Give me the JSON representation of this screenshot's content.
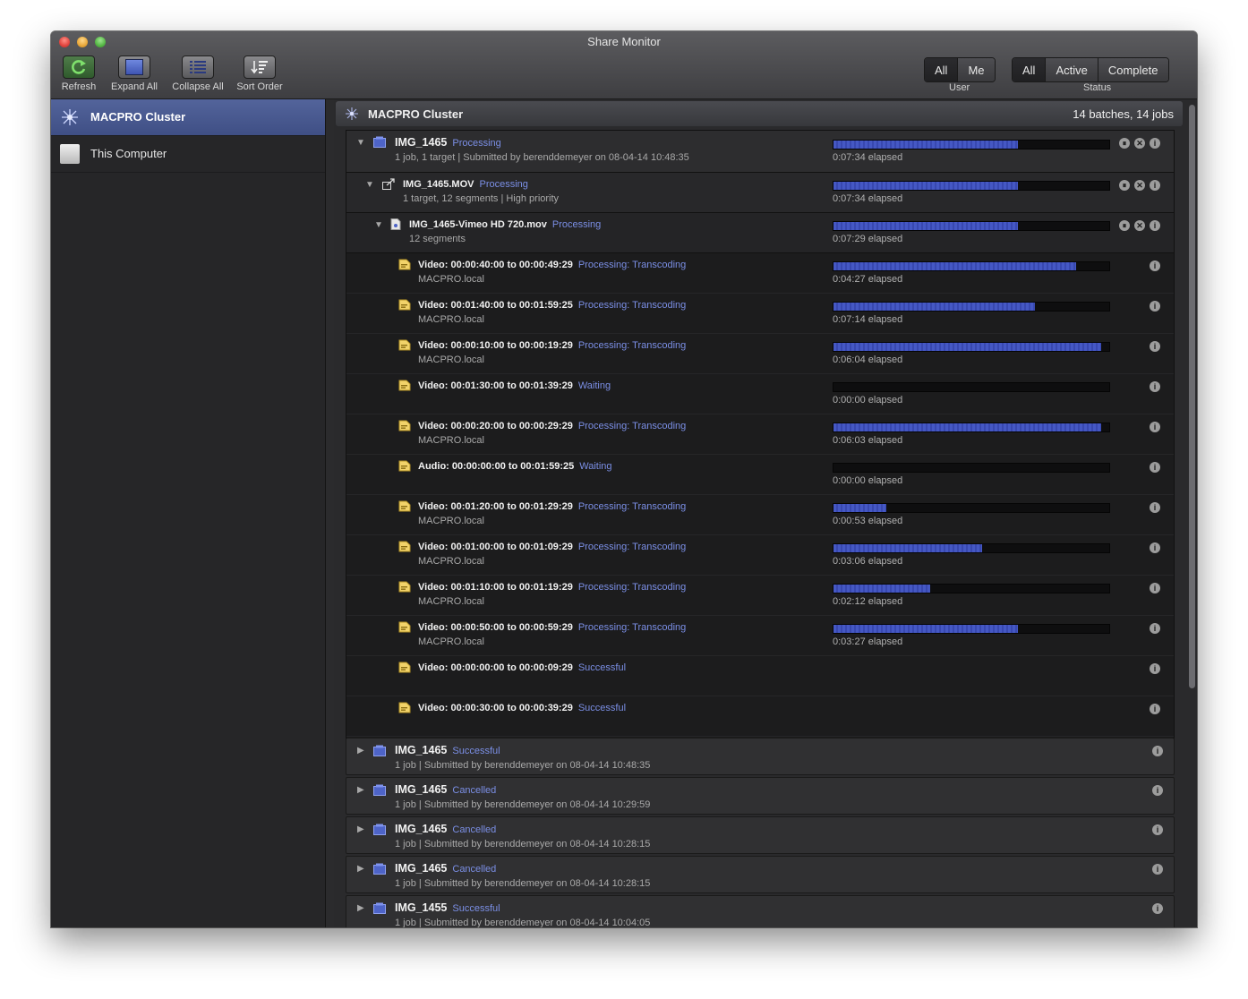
{
  "window": {
    "title": "Share Monitor"
  },
  "toolbar": {
    "refresh_label": "Refresh",
    "expand_label": "Expand All",
    "collapse_label": "Collapse All",
    "sort_label": "Sort Order"
  },
  "filters": {
    "user": {
      "label": "User",
      "options": [
        "All",
        "Me"
      ],
      "selected": "All"
    },
    "status": {
      "label": "Status",
      "options": [
        "All",
        "Active",
        "Complete"
      ],
      "selected": "All"
    }
  },
  "sidebar": {
    "items": [
      {
        "label": "MACPRO Cluster",
        "selected": true,
        "icon": "cluster-icon"
      },
      {
        "label": "This Computer",
        "selected": false,
        "icon": "computer-icon"
      }
    ]
  },
  "cluster": {
    "title": "MACPRO Cluster",
    "summary": "14 batches, 14 jobs"
  },
  "expanded_batch": {
    "title": "IMG_1465",
    "status": "Processing",
    "sub": "1 job, 1 target  |  Submitted by berenddemeyer on 08-04-14 10:48:35",
    "progress": 0.67,
    "elapsed": "0:07:34 elapsed",
    "job": {
      "title": "IMG_1465.MOV",
      "status": "Processing",
      "sub": "1 target, 12 segments  |  High priority",
      "progress": 0.67,
      "elapsed": "0:07:34 elapsed"
    },
    "target": {
      "title": "IMG_1465-Vimeo HD 720.mov",
      "status": "Processing",
      "sub": "12 segments",
      "progress": 0.67,
      "elapsed": "0:07:29 elapsed"
    },
    "segments": [
      {
        "title": "Video: 00:00:40:00 to 00:00:49:29",
        "status": "Processing: Transcoding",
        "host": "MACPRO.local",
        "progress": 0.88,
        "elapsed": "0:04:27 elapsed"
      },
      {
        "title": "Video: 00:01:40:00 to 00:01:59:25",
        "status": "Processing: Transcoding",
        "host": "MACPRO.local",
        "progress": 0.73,
        "elapsed": "0:07:14 elapsed"
      },
      {
        "title": "Video: 00:00:10:00 to 00:00:19:29",
        "status": "Processing: Transcoding",
        "host": "MACPRO.local",
        "progress": 0.97,
        "elapsed": "0:06:04 elapsed"
      },
      {
        "title": "Video: 00:01:30:00 to 00:01:39:29",
        "status": "Waiting",
        "host": "",
        "progress": 0,
        "elapsed": "0:00:00 elapsed"
      },
      {
        "title": "Video: 00:00:20:00 to 00:00:29:29",
        "status": "Processing: Transcoding",
        "host": "MACPRO.local",
        "progress": 0.97,
        "elapsed": "0:06:03 elapsed"
      },
      {
        "title": "Audio: 00:00:00:00 to 00:01:59:25",
        "status": "Waiting",
        "host": "",
        "progress": 0,
        "elapsed": "0:00:00 elapsed"
      },
      {
        "title": "Video: 00:01:20:00 to 00:01:29:29",
        "status": "Processing: Transcoding",
        "host": "MACPRO.local",
        "progress": 0.19,
        "elapsed": "0:00:53 elapsed"
      },
      {
        "title": "Video: 00:01:00:00 to 00:01:09:29",
        "status": "Processing: Transcoding",
        "host": "MACPRO.local",
        "progress": 0.54,
        "elapsed": "0:03:06 elapsed"
      },
      {
        "title": "Video: 00:01:10:00 to 00:01:19:29",
        "status": "Processing: Transcoding",
        "host": "MACPRO.local",
        "progress": 0.35,
        "elapsed": "0:02:12 elapsed"
      },
      {
        "title": "Video: 00:00:50:00 to 00:00:59:29",
        "status": "Processing: Transcoding",
        "host": "MACPRO.local",
        "progress": 0.67,
        "elapsed": "0:03:27 elapsed"
      },
      {
        "title": "Video: 00:00:00:00 to 00:00:09:29",
        "status": "Successful",
        "host": "",
        "progress": null,
        "elapsed": ""
      },
      {
        "title": "Video: 00:00:30:00 to 00:00:39:29",
        "status": "Successful",
        "host": "",
        "progress": null,
        "elapsed": ""
      }
    ]
  },
  "batches": [
    {
      "title": "IMG_1465",
      "status": "Successful",
      "sub": "1 job  |  Submitted by berenddemeyer on 08-04-14 10:48:35"
    },
    {
      "title": "IMG_1465",
      "status": "Cancelled",
      "sub": "1 job  |  Submitted by berenddemeyer on 08-04-14 10:29:59"
    },
    {
      "title": "IMG_1465",
      "status": "Cancelled",
      "sub": "1 job  |  Submitted by berenddemeyer on 08-04-14 10:28:15"
    },
    {
      "title": "IMG_1465",
      "status": "Cancelled",
      "sub": "1 job  |  Submitted by berenddemeyer on 08-04-14 10:28:15"
    },
    {
      "title": "IMG_1455",
      "status": "Successful",
      "sub": "1 job  |  Submitted by berenddemeyer on 08-04-14 10:04:05"
    }
  ],
  "colors": {
    "accent": "#4558c4",
    "status_text": "#7b8fe6",
    "selection": "#4a5a92"
  }
}
